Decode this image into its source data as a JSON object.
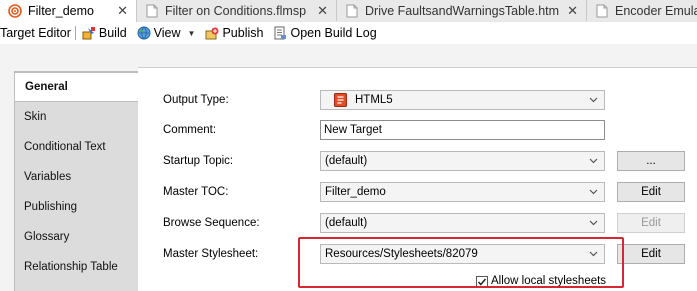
{
  "tabs": [
    {
      "label": "Filter_demo",
      "icon": "target-icon",
      "active": true,
      "close": "✕"
    },
    {
      "label": "Filter on Conditions.flmsp",
      "icon": "document-icon",
      "active": false,
      "close": "✕"
    },
    {
      "label": "Drive FaultsandWarningsTable.htm",
      "icon": "document-icon",
      "active": false,
      "close": "✕"
    },
    {
      "label": "Encoder Emulat",
      "icon": "document-icon",
      "active": false
    }
  ],
  "toolbar": {
    "title": "Target Editor",
    "build": "Build",
    "view": "View",
    "publish": "Publish",
    "open_build_log": "Open Build Log"
  },
  "sidebar": {
    "items": [
      {
        "label": "General",
        "active": true
      },
      {
        "label": "Skin"
      },
      {
        "label": "Conditional Text"
      },
      {
        "label": "Variables"
      },
      {
        "label": "Publishing"
      },
      {
        "label": "Glossary"
      },
      {
        "label": "Relationship Table"
      }
    ]
  },
  "form": {
    "output_type": {
      "label": "Output Type:",
      "value": "HTML5"
    },
    "comment": {
      "label": "Comment:",
      "value": "New Target"
    },
    "startup_topic": {
      "label": "Startup Topic:",
      "value": "(default)",
      "button": "..."
    },
    "master_toc": {
      "label": "Master TOC:",
      "value": "Filter_demo",
      "button": "Edit"
    },
    "browse_sequence": {
      "label": "Browse Sequence:",
      "value": "(default)",
      "button": "Edit",
      "button_disabled": true
    },
    "master_stylesheet": {
      "label": "Master Stylesheet:",
      "value": "Resources/Stylesheets/82079",
      "button": "Edit"
    },
    "allow_local_stylesheets": {
      "label": "Allow local stylesheets",
      "checked": true
    }
  },
  "colors": {
    "highlight_box": "#d7282f",
    "accent_orange": "#e05a1c"
  }
}
